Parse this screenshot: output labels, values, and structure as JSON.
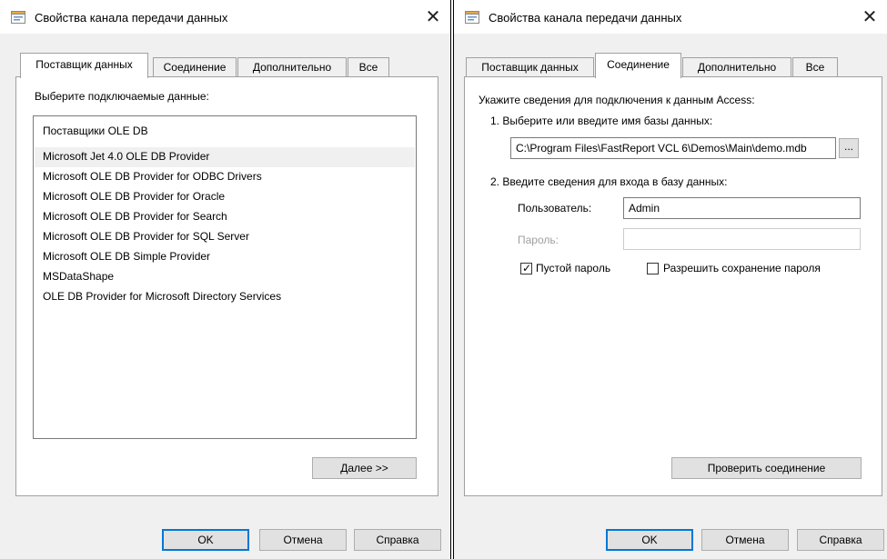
{
  "dialog_title": "Свойства канала передачи данных",
  "tabs": [
    "Поставщик данных",
    "Соединение",
    "Дополнительно",
    "Все"
  ],
  "left": {
    "prompt": "Выберите подключаемые данные:",
    "list_header": "Поставщики OLE DB",
    "providers": [
      "Microsoft Jet 4.0 OLE DB Provider",
      "Microsoft OLE DB Provider for ODBC Drivers",
      "Microsoft OLE DB Provider for Oracle",
      "Microsoft OLE DB Provider for Search",
      "Microsoft OLE DB Provider for SQL Server",
      "Microsoft OLE DB Simple Provider",
      "MSDataShape",
      "OLE DB Provider for Microsoft Directory Services"
    ],
    "selected_provider": "Microsoft Jet 4.0 OLE DB Provider",
    "next_button": "Далее >>"
  },
  "right": {
    "intro": "Укажите сведения для подключения к данным Access:",
    "step1": "1. Выберите или введите имя базы данных:",
    "db_path": "C:\\Program Files\\FastReport VCL 6\\Demos\\Main\\demo.mdb",
    "browse_button": "...",
    "step2": "2. Введите сведения для входа в базу данных:",
    "user_label": "Пользователь:",
    "user_value": "Admin",
    "password_label": "Пароль:",
    "password_value": "",
    "blank_password_label": "Пустой пароль",
    "blank_password_checked": true,
    "allow_save_label": "Разрешить сохранение пароля",
    "allow_save_checked": false,
    "test_button": "Проверить соединение"
  },
  "footer": {
    "ok": "OK",
    "cancel": "Отмена",
    "help": "Справка"
  },
  "colors": {
    "focus_border": "#0078d7",
    "dialog_bg": "#f0f0f0",
    "selection_bg": "#f0f0f0"
  }
}
